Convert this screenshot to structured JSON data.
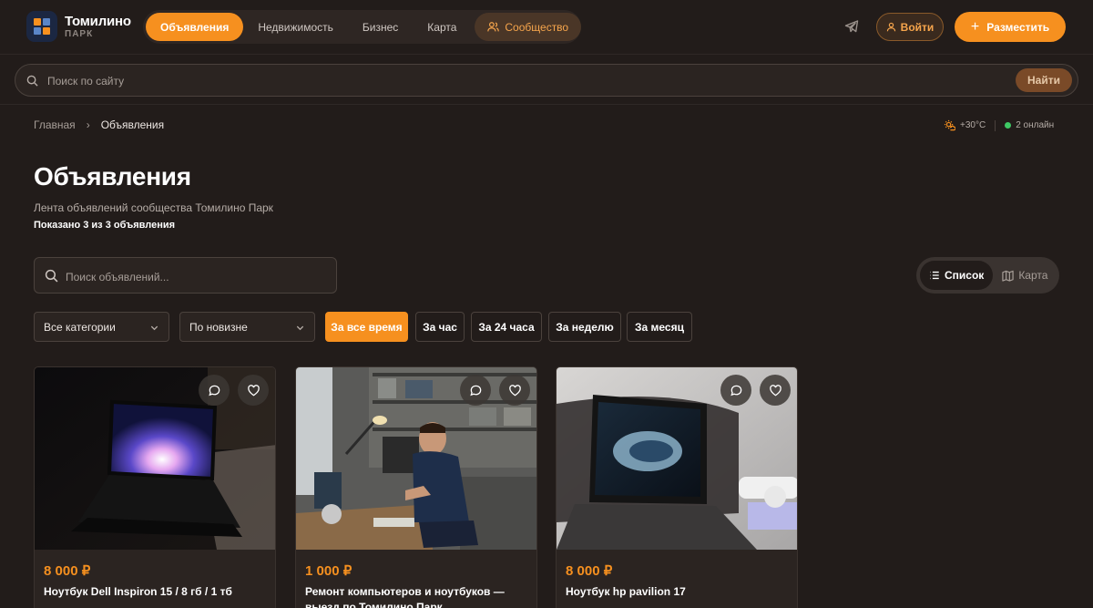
{
  "header": {
    "logo_title": "Томилино",
    "logo_sub": "ПАРК",
    "nav": [
      {
        "label": "Объявления"
      },
      {
        "label": "Недвижимость"
      },
      {
        "label": "Бизнес"
      },
      {
        "label": "Карта"
      },
      {
        "label": "Сообщество"
      }
    ],
    "login_label": "Войти",
    "post_label": "Разместить"
  },
  "site_search": {
    "placeholder": "Поиск по сайту",
    "button_label": "Найти"
  },
  "breadcrumb": {
    "home": "Главная",
    "current": "Объявления"
  },
  "status": {
    "temperature": "+30°C",
    "online": "2 онлайн"
  },
  "page": {
    "title": "Объявления",
    "subtitle": "Лента объявлений сообщества Томилино Парк",
    "count": "Показано 3 из 3 объявления"
  },
  "ad_search": {
    "placeholder": "Поиск объявлений..."
  },
  "view_toggle": {
    "list_label": "Список",
    "map_label": "Карта"
  },
  "filters": {
    "category": "Все категории",
    "sort": "По новизне",
    "time": [
      {
        "label": "За все время"
      },
      {
        "label": "За час"
      },
      {
        "label": "За 24 часа"
      },
      {
        "label": "За неделю"
      },
      {
        "label": "За месяц"
      }
    ]
  },
  "listings": [
    {
      "price": "8 000 ₽",
      "title": "Ноутбук Dell Inspiron 15 / 8 гб / 1 тб"
    },
    {
      "price": "1 000 ₽",
      "title": "Ремонт компьютеров и ноутбуков — выезд по Томилино Парк"
    },
    {
      "price": "8 000 ₽",
      "title": "Ноутбук hp pavilion 17"
    }
  ],
  "colors": {
    "accent": "#f6901f",
    "background": "#221c1a",
    "surface": "#2b2421",
    "online": "#3ec864"
  }
}
